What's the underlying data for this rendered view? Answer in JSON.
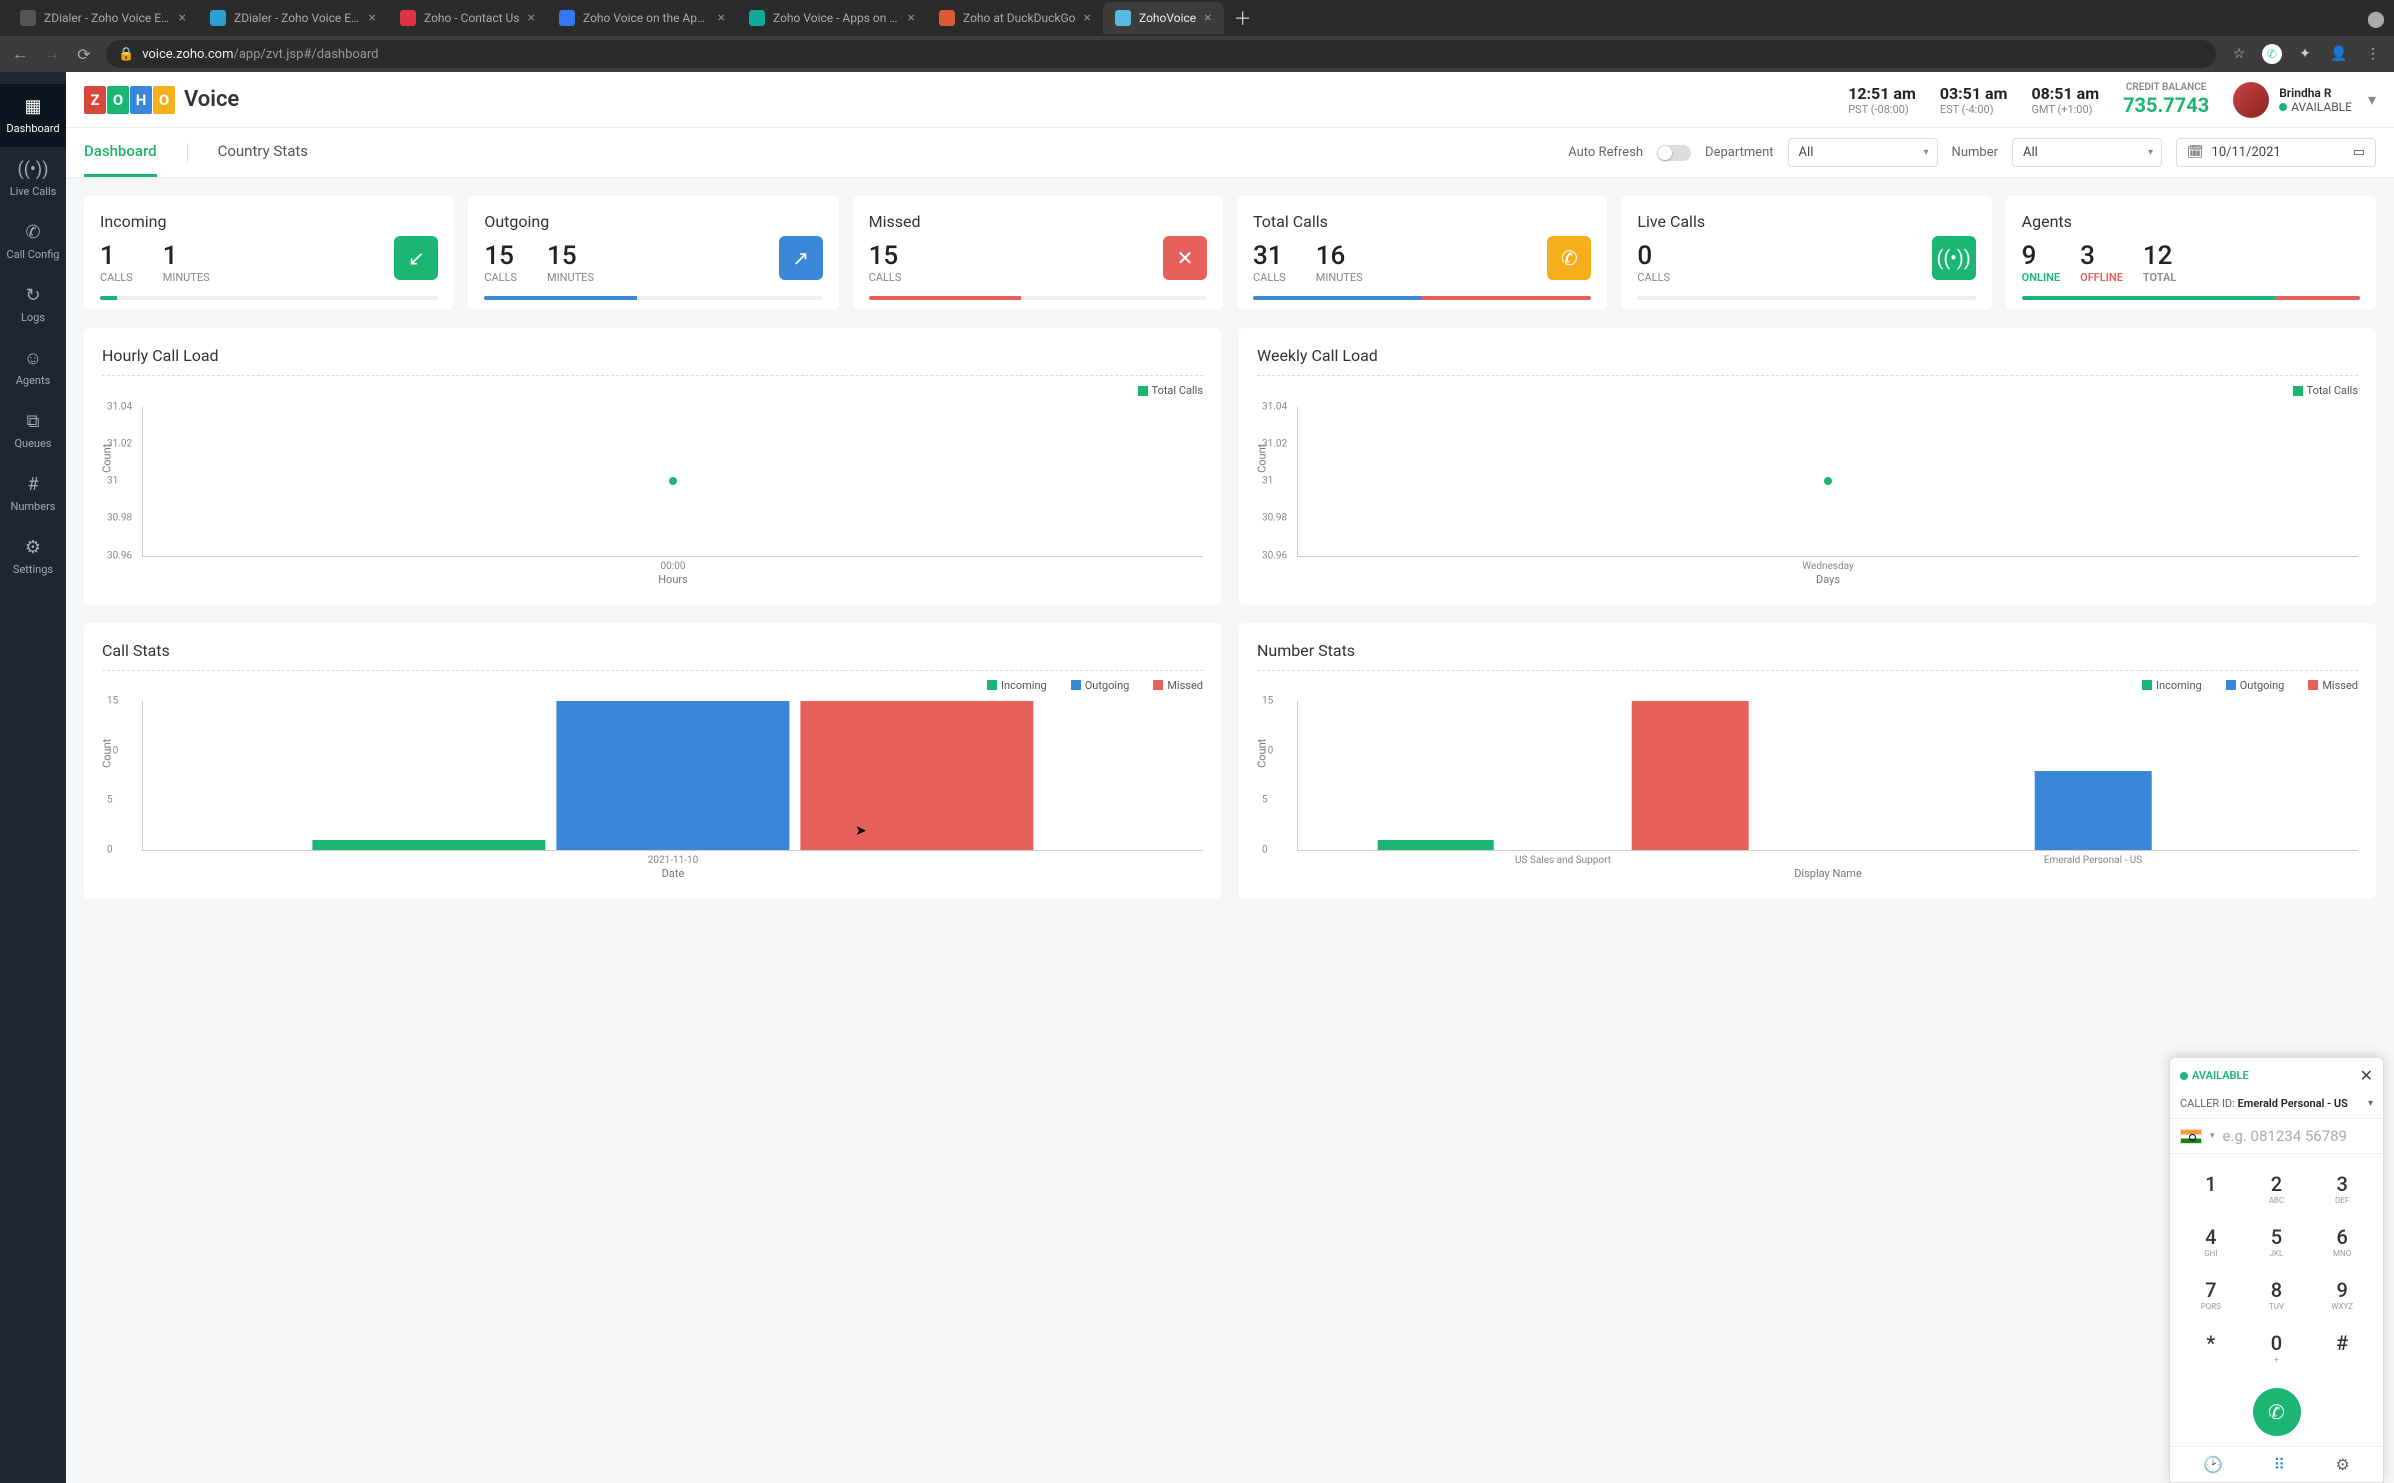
{
  "browser": {
    "tabs": [
      {
        "title": "ZDialer - Zoho Voice Extens",
        "favicon": "#555"
      },
      {
        "title": "ZDialer - Zoho Voice Extens",
        "favicon": "#2a9fd6"
      },
      {
        "title": "Zoho - Contact Us",
        "favicon": "#d34"
      },
      {
        "title": "Zoho Voice on the App Sto",
        "favicon": "#3478f6"
      },
      {
        "title": "Zoho Voice - Apps on Goog",
        "favicon": "#1a9"
      },
      {
        "title": "Zoho at DuckDuckGo",
        "favicon": "#de5833"
      },
      {
        "title": "ZohoVoice",
        "favicon": "#5bd",
        "active": true
      }
    ],
    "url_host": "voice.zoho.com",
    "url_path": "/app/zvt.jsp#/dashboard"
  },
  "logo": {
    "letters": [
      "Z",
      "O",
      "H",
      "O"
    ],
    "colors": [
      "#d9463a",
      "#1bb574",
      "#3a86d9",
      "#f4af1a"
    ],
    "word": "Voice"
  },
  "header": {
    "clocks": [
      {
        "time": "12:51 am",
        "tz": "PST (-08:00)"
      },
      {
        "time": "03:51 am",
        "tz": "EST (-4:00)"
      },
      {
        "time": "08:51 am",
        "tz": "GMT (+1:00)"
      }
    ],
    "credit_label": "CREDIT BALANCE",
    "credit_value": "735.7743",
    "user_name": "Brindha R",
    "user_status": "AVAILABLE"
  },
  "sidebar": [
    {
      "icon": "▦",
      "label": "Dashboard",
      "active": true
    },
    {
      "icon": "((•))",
      "label": "Live Calls"
    },
    {
      "icon": "✆",
      "label": "Call Config"
    },
    {
      "icon": "↻",
      "label": "Logs"
    },
    {
      "icon": "☺",
      "label": "Agents"
    },
    {
      "icon": "⧉",
      "label": "Queues"
    },
    {
      "icon": "#",
      "label": "Numbers"
    },
    {
      "icon": "⚙",
      "label": "Settings"
    }
  ],
  "subhead": {
    "tabs": [
      "Dashboard",
      "Country Stats"
    ],
    "auto_refresh": "Auto Refresh",
    "dept_label": "Department",
    "dept_value": "All",
    "num_label": "Number",
    "num_value": "All",
    "date": "10/11/2021"
  },
  "cards": {
    "incoming": {
      "title": "Incoming",
      "v1": "1",
      "l1": "CALLS",
      "v2": "1",
      "l2": "MINUTES",
      "color": "#1bb574",
      "icon": "↙",
      "bar_pct": 5
    },
    "outgoing": {
      "title": "Outgoing",
      "v1": "15",
      "l1": "CALLS",
      "v2": "15",
      "l2": "MINUTES",
      "color": "#3a86d9",
      "icon": "↗",
      "bar_pct": 45
    },
    "missed": {
      "title": "Missed",
      "v1": "15",
      "l1": "CALLS",
      "color": "#e8605c",
      "icon": "✕",
      "bar_pct": 45
    },
    "total": {
      "title": "Total Calls",
      "v1": "31",
      "l1": "CALLS",
      "v2": "16",
      "l2": "MINUTES",
      "color": "#f4af1a",
      "icon": "✆",
      "bar_green": 50,
      "bar_red": 50
    },
    "live": {
      "title": "Live Calls",
      "v1": "0",
      "l1": "CALLS",
      "color": "#1bb574",
      "icon": "((•))",
      "bar_pct": 0
    },
    "agents": {
      "title": "Agents",
      "online": "9",
      "online_l": "ONLINE",
      "offline": "3",
      "offline_l": "OFFLINE",
      "total": "12",
      "total_l": "TOTAL",
      "bar_green": 75,
      "bar_red": 25
    }
  },
  "chart_data": [
    {
      "id": "hourly",
      "type": "scatter",
      "title": "Hourly Call Load",
      "xlabel": "Hours",
      "ylabel": "Count",
      "x": [
        "00:00"
      ],
      "y": [
        31
      ],
      "ylim": [
        30.96,
        31.04
      ],
      "yticks": [
        30.96,
        30.98,
        31,
        31.02,
        31.04
      ],
      "legend": [
        "Total Calls"
      ],
      "legend_colors": [
        "#1bb574"
      ]
    },
    {
      "id": "weekly",
      "type": "scatter",
      "title": "Weekly Call Load",
      "xlabel": "Days",
      "ylabel": "Count",
      "x": [
        "Wednesday"
      ],
      "y": [
        31
      ],
      "ylim": [
        30.96,
        31.04
      ],
      "yticks": [
        30.96,
        30.98,
        31,
        31.02,
        31.04
      ],
      "legend": [
        "Total Calls"
      ],
      "legend_colors": [
        "#1bb574"
      ]
    },
    {
      "id": "callstats",
      "type": "bar",
      "title": "Call Stats",
      "xlabel": "Date",
      "ylabel": "Count",
      "categories": [
        "2021-11-10"
      ],
      "series": [
        {
          "name": "Incoming",
          "color": "#1bb574",
          "values": [
            1
          ]
        },
        {
          "name": "Outgoing",
          "color": "#3a86d9",
          "values": [
            15
          ]
        },
        {
          "name": "Missed",
          "color": "#e8605c",
          "values": [
            15
          ]
        }
      ],
      "ylim": [
        0,
        15
      ],
      "yticks": [
        0,
        5,
        10,
        15
      ]
    },
    {
      "id": "numberstats",
      "type": "bar",
      "title": "Number Stats",
      "xlabel": "Display Name",
      "ylabel": "Count",
      "categories": [
        "US Sales and Support",
        "Emerald Personal - US"
      ],
      "series": [
        {
          "name": "Incoming",
          "color": "#1bb574",
          "values": [
            1,
            0
          ]
        },
        {
          "name": "Outgoing",
          "color": "#3a86d9",
          "values": [
            0,
            8
          ]
        },
        {
          "name": "Missed",
          "color": "#e8605c",
          "values": [
            15,
            0
          ]
        }
      ],
      "ylim": [
        0,
        15
      ],
      "yticks": [
        0,
        5,
        10,
        15
      ]
    }
  ],
  "dialer": {
    "status": "AVAILABLE",
    "caller_id_label": "CALLER ID:",
    "caller_id_value": "Emerald Personal - US",
    "placeholder": "e.g. 081234 56789",
    "keys": [
      [
        "1",
        ""
      ],
      [
        "2",
        "ABC"
      ],
      [
        "3",
        "DEF"
      ],
      [
        "4",
        "GHI"
      ],
      [
        "5",
        "JKL"
      ],
      [
        "6",
        "MNO"
      ],
      [
        "7",
        "PQRS"
      ],
      [
        "8",
        "TUV"
      ],
      [
        "9",
        "WXYZ"
      ],
      [
        "*",
        ""
      ],
      [
        "0",
        "+"
      ],
      [
        "#",
        ""
      ]
    ]
  }
}
